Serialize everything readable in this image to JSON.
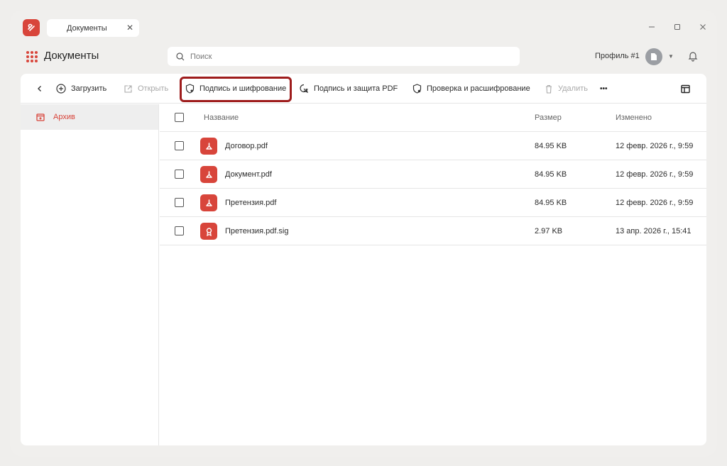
{
  "window": {
    "tab_label": "Документы",
    "tab_close": "✕",
    "controls": [
      "minimize-icon",
      "maximize-icon",
      "close-icon"
    ]
  },
  "header": {
    "title": "Документы",
    "search_placeholder": "Поиск",
    "profile_label": "Профиль #1"
  },
  "toolbar": {
    "upload": "Загрузить",
    "open": "Открыть",
    "sign_encrypt": "Подпись и шифрование",
    "sign_protect_pdf": "Подпись и защита PDF",
    "verify_decrypt": "Проверка и расшифрование",
    "delete": "Удалить",
    "more": "•••"
  },
  "sidebar": {
    "items": [
      {
        "label": "Архив",
        "icon": "archive-icon",
        "active": true
      }
    ]
  },
  "table": {
    "columns": {
      "name": "Название",
      "size": "Размер",
      "modified": "Изменено"
    },
    "rows": [
      {
        "name": "Договор.pdf",
        "size": "84.95 KB",
        "modified": "12 февр. 2026 г., 9:59",
        "icon": "pdf-icon"
      },
      {
        "name": "Документ.pdf",
        "size": "84.95 KB",
        "modified": "12 февр. 2026 г., 9:59",
        "icon": "pdf-icon"
      },
      {
        "name": "Претензия.pdf",
        "size": "84.95 KB",
        "modified": "12 февр. 2026 г., 9:59",
        "icon": "pdf-icon"
      },
      {
        "name": "Претензия.pdf.sig",
        "size": "2.97 KB",
        "modified": "13 апр. 2026 г., 15:41",
        "icon": "signature-icon"
      }
    ]
  },
  "colors": {
    "accent": "#d8453b",
    "highlight": "#9e1c1c"
  }
}
